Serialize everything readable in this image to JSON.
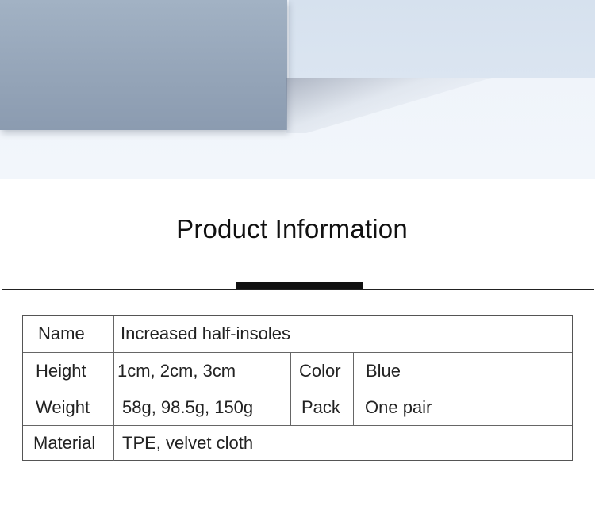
{
  "heading": "Product Information",
  "spec": {
    "rows": [
      {
        "label": "Name",
        "value": "Increased half-insoles"
      },
      {
        "label": "Height",
        "value": "1cm, 2cm, 3cm",
        "label2": "Color",
        "value2": "Blue"
      },
      {
        "label": "Weight",
        "value": "58g, 98.5g, 150g",
        "label2": "Pack",
        "value2": "One pair"
      },
      {
        "label": "Material",
        "value": "TPE, velvet cloth"
      }
    ]
  }
}
